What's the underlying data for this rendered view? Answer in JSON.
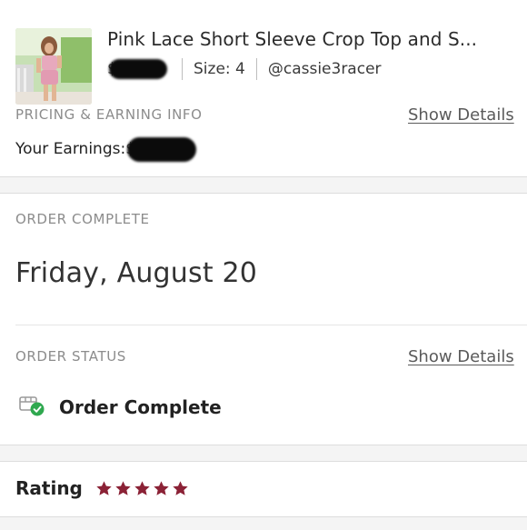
{
  "listing": {
    "title": "Pink Lace Short Sleeve Crop Top and S...",
    "price_visible": "$",
    "size": "Size: 4",
    "seller": "@cassie3racer"
  },
  "pricing": {
    "section_label": "PRICING & EARNING INFO",
    "show_details": "Show Details",
    "earnings_label": "Your Earnings:",
    "earnings_visible": "$"
  },
  "order": {
    "section_label": "ORDER COMPLETE",
    "date": "Friday, August 20"
  },
  "status": {
    "section_label": "ORDER STATUS",
    "show_details": "Show Details",
    "value": "Order Complete"
  },
  "rating": {
    "label": "Rating",
    "stars": 5
  },
  "colors": {
    "star": "#8b2236",
    "check": "#2fa84f",
    "link": "#5a5a5a"
  }
}
